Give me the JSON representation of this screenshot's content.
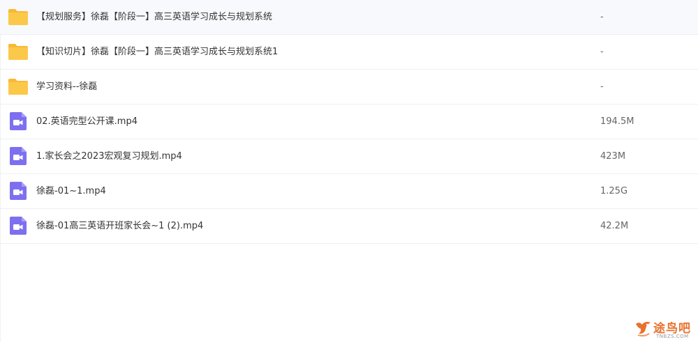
{
  "files": [
    {
      "type": "folder",
      "icon": "folder-icon",
      "name": "【规划服务】徐磊【阶段一】高三英语学习成长与规划系统",
      "size": "-"
    },
    {
      "type": "folder",
      "icon": "folder-icon",
      "name": "【知识切片】徐磊【阶段一】高三英语学习成长与规划系统1",
      "size": "-"
    },
    {
      "type": "folder",
      "icon": "folder-icon",
      "name": "学习资料--徐磊",
      "size": "-"
    },
    {
      "type": "video",
      "icon": "video-file-icon",
      "name": "02.英语完型公开课.mp4",
      "size": "194.5M"
    },
    {
      "type": "video",
      "icon": "video-file-icon",
      "name": "1.家长会之2023宏观复习规划.mp4",
      "size": "423M"
    },
    {
      "type": "video",
      "icon": "video-file-icon",
      "name": "徐磊-01~1.mp4",
      "size": "1.25G"
    },
    {
      "type": "video",
      "icon": "video-file-icon",
      "name": "徐磊-01高三英语开班家长会~1 (2).mp4",
      "size": "42.2M"
    }
  ],
  "colors": {
    "folder": "#fcc84a",
    "video": "#7d6ff0",
    "watermark": "#e8722e"
  },
  "watermark": {
    "title": "途鸟吧",
    "subtitle": "TNBZS.COM"
  }
}
